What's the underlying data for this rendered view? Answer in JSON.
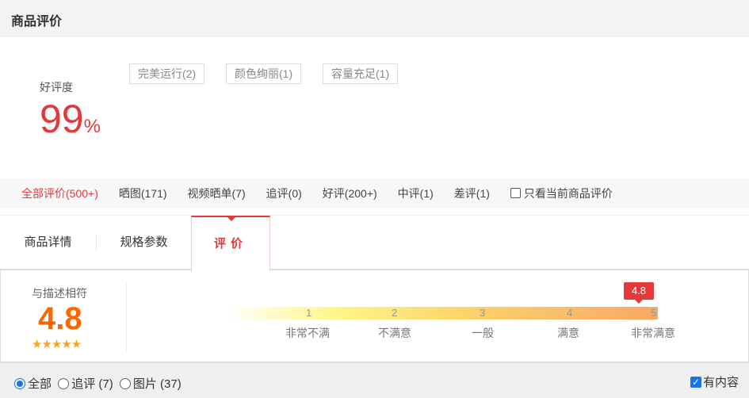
{
  "header": {
    "title": "商品评价"
  },
  "summary": {
    "good_rate_label": "好评度",
    "good_rate_value": "99",
    "good_rate_unit": "%",
    "tags": [
      "完美运行(2)",
      "颜色绚丽(1)",
      "容量充足(1)"
    ]
  },
  "filters": {
    "items": [
      "全部评价(500+)",
      "晒图(171)",
      "视频晒单(7)",
      "追评(0)",
      "好评(200+)",
      "中评(1)",
      "差评(1)"
    ],
    "active": 0,
    "only_current_label": "只看当前商品评价",
    "only_current_checked": false
  },
  "tabs": {
    "items": [
      "商品详情",
      "规格参数",
      "评价"
    ],
    "active": 2
  },
  "rating": {
    "label": "与描述相符",
    "score": "4.8",
    "stars": "★★★★★",
    "marker": "4.8",
    "scale": [
      "1",
      "2",
      "3",
      "4",
      "5"
    ],
    "levels": [
      "非常不满",
      "不满意",
      "一般",
      "满意",
      "非常满意"
    ]
  },
  "bottom": {
    "options": [
      "全部",
      "追评 (7)",
      "图片 (37)"
    ],
    "selected": 0,
    "has_content_label": "有内容",
    "has_content_checked": true
  },
  "colors": {
    "accent": "#e4393c",
    "score": "#ff6600",
    "star": "#f5a623"
  }
}
